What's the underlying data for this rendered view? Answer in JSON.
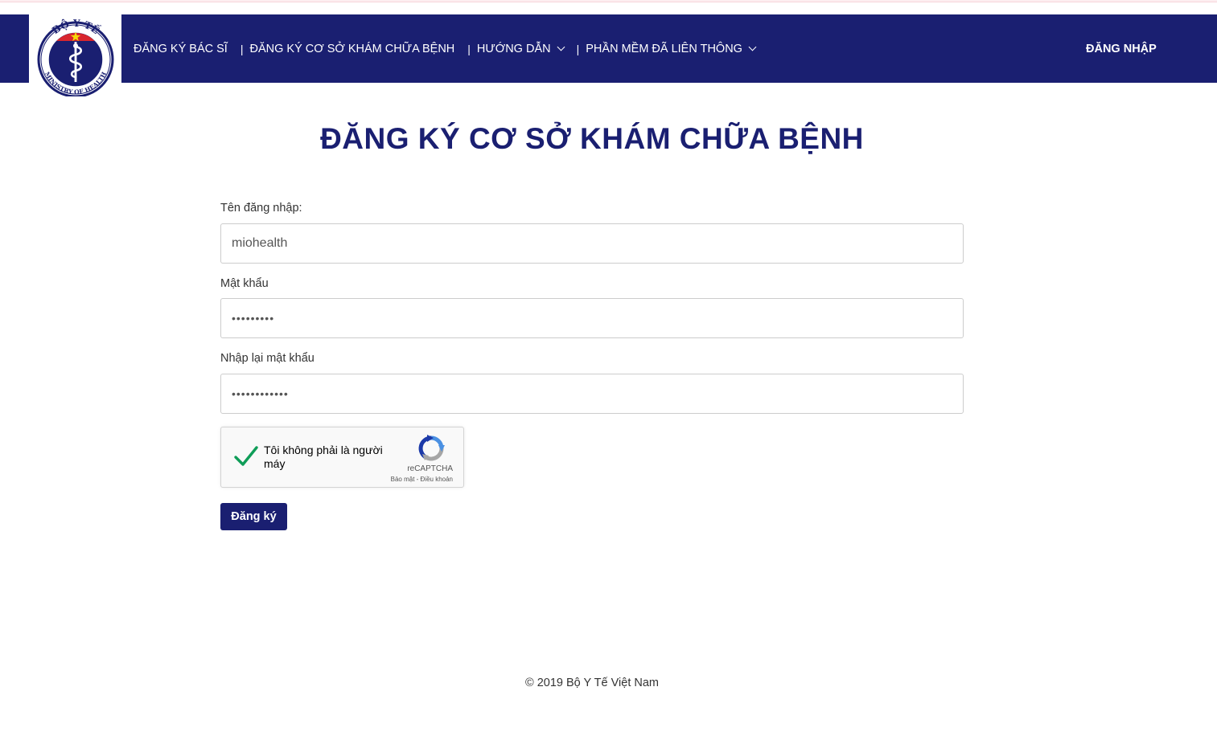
{
  "logo": {
    "top_text": "BỘ Y TẾ",
    "bottom_text": "MINISTRY OF HEALTH",
    "colors": {
      "ring": "#1a1f71",
      "red": "#d8262e",
      "star": "#f5d90a"
    }
  },
  "nav": {
    "items": [
      {
        "label": "ĐĂNG KÝ BÁC SĨ"
      },
      {
        "label": "ĐĂNG KÝ CƠ SỞ KHÁM CHỮA BỆNH"
      },
      {
        "label": "HƯỚNG DẪN"
      },
      {
        "label": "PHẦN MỀM ĐÃ LIÊN THÔNG"
      }
    ],
    "separator": "|",
    "login": "ĐĂNG NHẬP"
  },
  "page": {
    "title": "ĐĂNG KÝ CƠ SỞ KHÁM CHỮA BỆNH"
  },
  "form": {
    "username_label": "Tên đăng nhập:",
    "username_value": "miohealth",
    "password_label": "Mật khẩu",
    "password_value": "123456789",
    "confirm_label": "Nhập lại mật khẩu",
    "confirm_value": "123456789012",
    "submit_label": "Đăng ký"
  },
  "captcha": {
    "text": "Tôi không phải là người máy",
    "brand": "reCAPTCHA",
    "terms": "Bảo mật - Điều khoản",
    "checked": true
  },
  "footer": {
    "text": "© 2019 Bộ Y Tế Việt Nam"
  },
  "theme": {
    "primary": "#1a1f71",
    "check_green": "#0f9d58"
  }
}
